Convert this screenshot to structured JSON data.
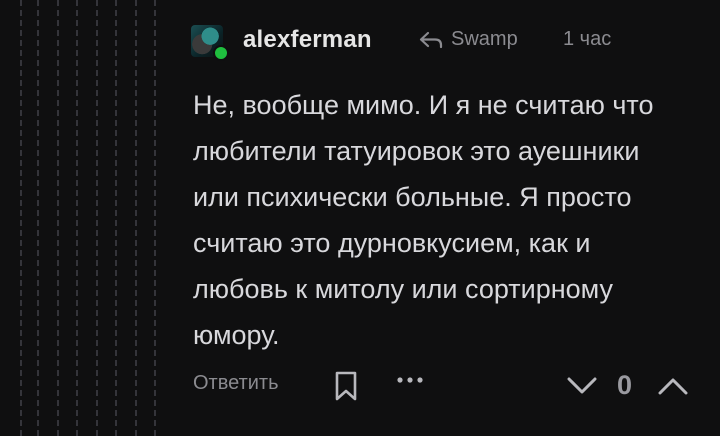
{
  "comment": {
    "author": "alexferman",
    "reply_to": "Swamp",
    "time": "1 час",
    "text": "Не, вообще мимо. И я не считаю что любители татуировок это ауешники или психически больные. Я просто считаю это дурновкусием, как и любовь к митолу или сортирному юмору.",
    "online": true
  },
  "actions": {
    "reply_label": "Ответить",
    "rating": "0"
  },
  "icons": {
    "reply": "reply-arrow-icon",
    "bookmark": "bookmark-icon",
    "more": "more-dots-icon",
    "downvote": "chevron-down-icon",
    "upvote": "chevron-up-icon"
  },
  "colors": {
    "background": "#0f0f10",
    "text": "#d8d8dc",
    "muted": "#8b8b90",
    "online": "#1fbf3f"
  }
}
